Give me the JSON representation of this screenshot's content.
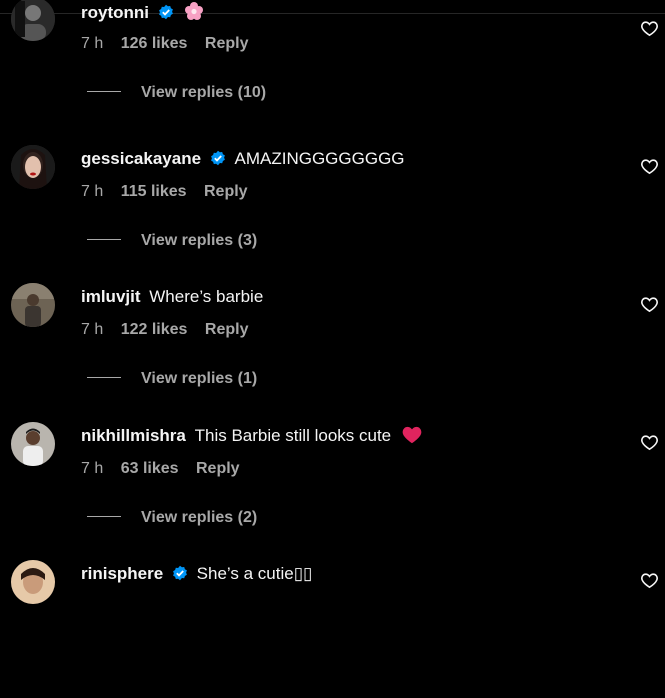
{
  "comments": [
    {
      "username": "roytonni",
      "verified": true,
      "text": "",
      "emoji": "flower",
      "time": "7 h",
      "likes": "126 likes",
      "reply": "Reply",
      "view_replies": "View replies (10)"
    },
    {
      "username": "gessicakayane",
      "verified": true,
      "text": "AMAZINGGGGGGGG",
      "emoji": "",
      "time": "7 h",
      "likes": "115 likes",
      "reply": "Reply",
      "view_replies": "View replies (3)"
    },
    {
      "username": "imluvjit",
      "verified": false,
      "text": "Where’s barbie",
      "emoji": "",
      "time": "7 h",
      "likes": "122 likes",
      "reply": "Reply",
      "view_replies": "View replies (1)"
    },
    {
      "username": "nikhillmishra",
      "verified": false,
      "text": "This Barbie still looks cute",
      "emoji": "red-heart",
      "time": "7 h",
      "likes": "63 likes",
      "reply": "Reply",
      "view_replies": "View replies (2)"
    },
    {
      "username": "rinisphere",
      "verified": true,
      "text": "She’s a cutie▯▯",
      "emoji": "",
      "time": "",
      "likes": "",
      "reply": "",
      "view_replies": ""
    }
  ],
  "colors": {
    "background": "#000000",
    "primary_text": "#f5f5f5",
    "secondary_text": "#a8a8a8",
    "verified_badge": "#0095f6",
    "heart_emoji": "#e0245e"
  },
  "icons": {
    "like": "heart-outline-icon",
    "verified": "verified-badge-icon"
  }
}
